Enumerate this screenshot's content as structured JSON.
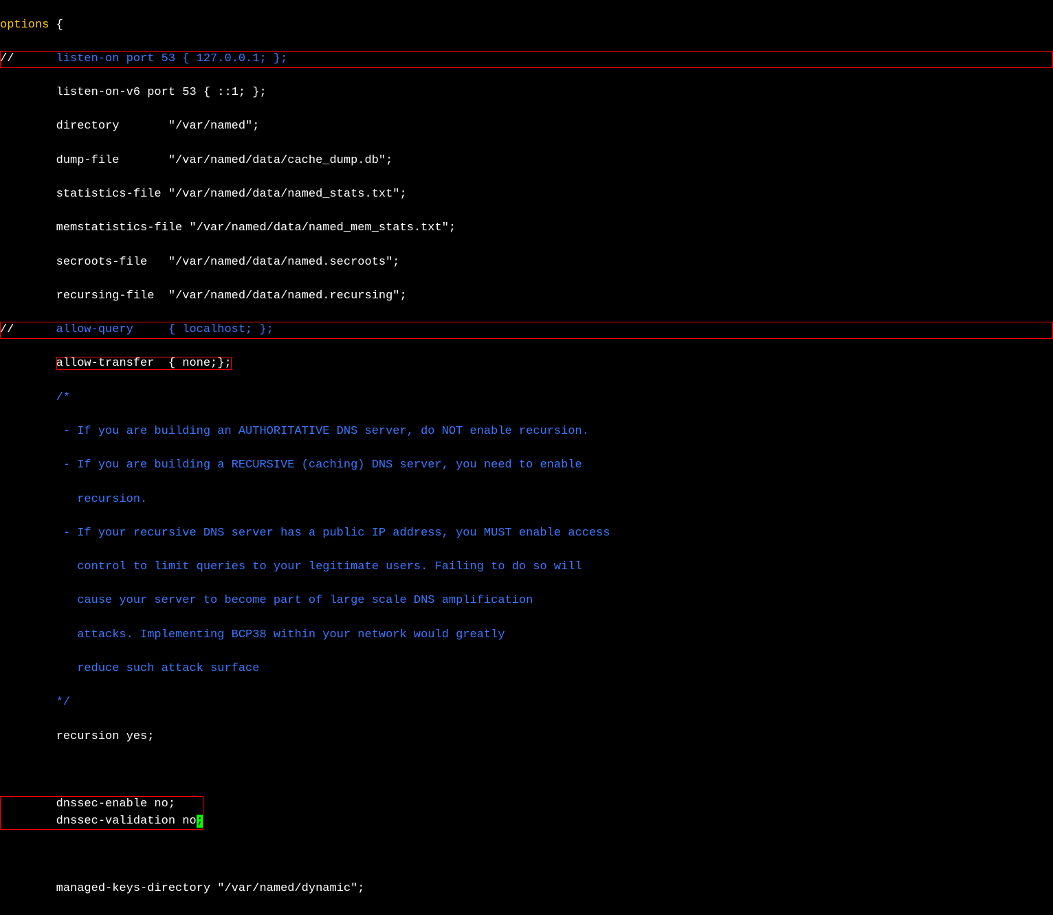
{
  "lines": {
    "l0_kw": "options",
    "l0_rest": " {",
    "l1_slash": "//",
    "l1_rest": "      listen-on port 53 { 127.0.0.1; };",
    "l2": "        listen-on-v6 port 53 { ::1; };",
    "l3": "        directory       \"/var/named\";",
    "l4": "        dump-file       \"/var/named/data/cache_dump.db\";",
    "l5": "        statistics-file \"/var/named/data/named_stats.txt\";",
    "l6": "        memstatistics-file \"/var/named/data/named_mem_stats.txt\";",
    "l7": "        secroots-file   \"/var/named/data/named.secroots\";",
    "l8": "        recursing-file  \"/var/named/data/named.recursing\";",
    "l9_slash": "//",
    "l9_rest": "      allow-query     { localhost; };",
    "l10_pre": "        ",
    "l10_box": "allow-transfer  { none;};",
    "l11": "        /*",
    "l12": "         - If you are building an AUTHORITATIVE DNS server, do NOT enable recursion.",
    "l13": "         - If you are building a RECURSIVE (caching) DNS server, you need to enable",
    "l14": "           recursion.",
    "l15": "         - If your recursive DNS server has a public IP address, you MUST enable access",
    "l16": "           control to limit queries to your legitimate users. Failing to do so will",
    "l17": "           cause your server to become part of large scale DNS amplification",
    "l18": "           attacks. Implementing BCP38 within your network would greatly",
    "l19": "           reduce such attack surface",
    "l20": "        */",
    "l21": "        recursion yes;",
    "l22": " ",
    "l23a": "        dnssec-enable no;",
    "l23b_pre": "        dnssec-validation no",
    "l23b_cursor": ";",
    "l24": " ",
    "l25": "        managed-keys-directory \"/var/named/dynamic\";"
  }
}
